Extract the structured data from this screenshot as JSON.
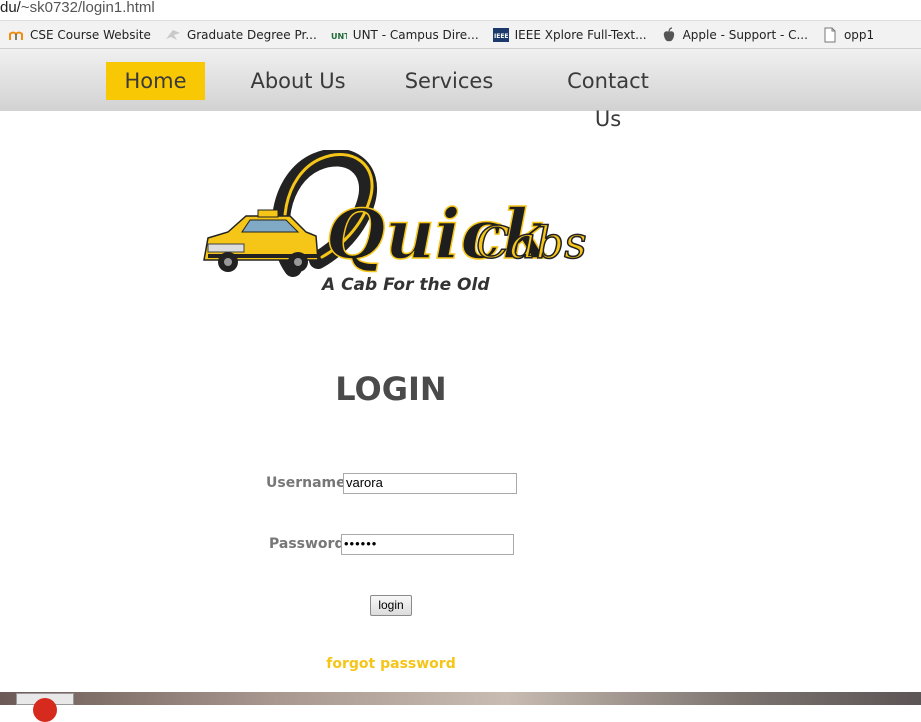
{
  "browser": {
    "url_host": "du/",
    "url_path": "~sk0732/login1.html",
    "bookmarks": [
      {
        "label": "CSE Course Website",
        "icon": "moodle-icon"
      },
      {
        "label": "Graduate Degree Pr...",
        "icon": "eagle-icon"
      },
      {
        "label": "UNT - Campus Dire...",
        "icon": "unt-icon"
      },
      {
        "label": "IEEE Xplore Full-Text...",
        "icon": "ieee-icon"
      },
      {
        "label": "Apple - Support - C...",
        "icon": "apple-icon"
      },
      {
        "label": "opp1",
        "icon": "page-icon"
      }
    ]
  },
  "nav": {
    "items": [
      {
        "label": "Home",
        "active": true
      },
      {
        "label": "About Us",
        "active": false
      },
      {
        "label": "Services",
        "active": false
      },
      {
        "label": "Contact Us",
        "active": false
      }
    ],
    "accent": "#f9c804"
  },
  "logo": {
    "wordmark_left": "Quick",
    "wordmark_right": "Cabs",
    "tagline": "A Cab For the Old",
    "color": "#f5c518"
  },
  "login": {
    "title": "LOGIN",
    "username_label": "Username:",
    "username_value": "varora",
    "password_label": "Password:",
    "password_value": "••••••",
    "button_label": "login",
    "forgot_label": "forgot password"
  }
}
